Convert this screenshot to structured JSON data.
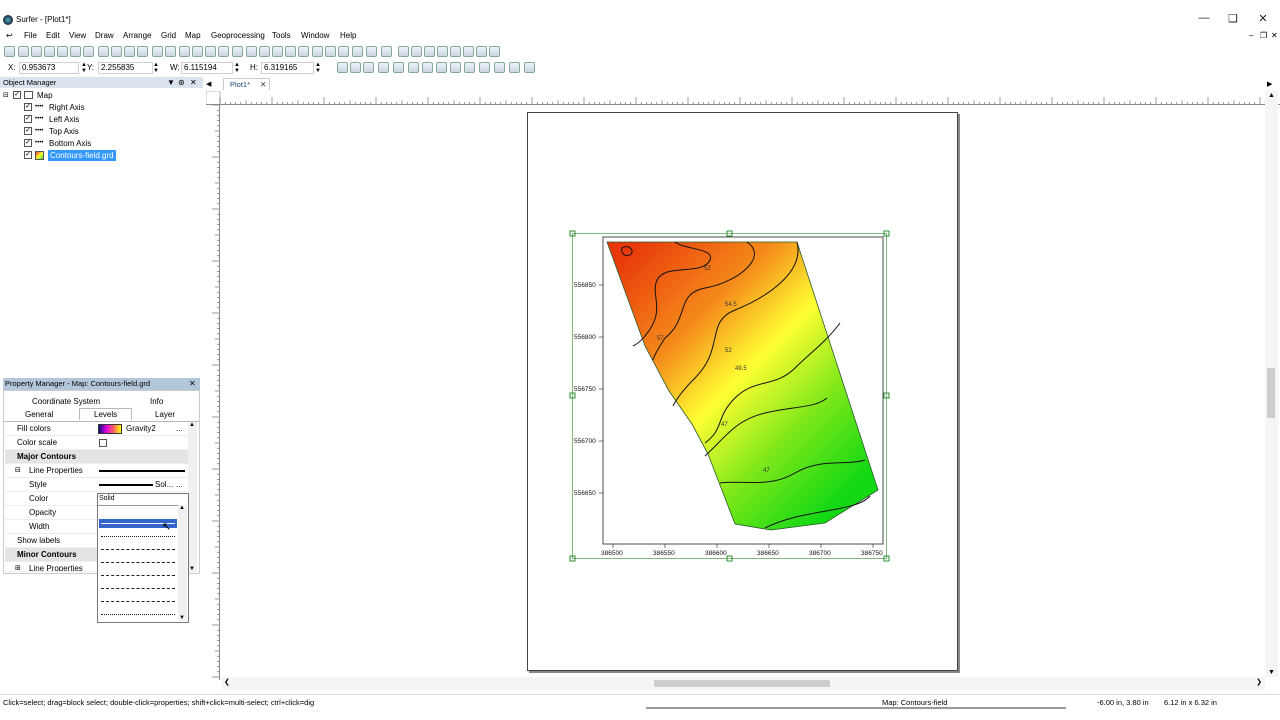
{
  "app": {
    "title": "Surfer - [Plot1*]"
  },
  "menu": [
    "File",
    "Edit",
    "View",
    "Draw",
    "Arrange",
    "Grid",
    "Map",
    "Geoprocessing",
    "Tools",
    "Window",
    "Help"
  ],
  "coords": {
    "x_label": "X:",
    "x_value": "0.953673",
    "y_label": "Y:",
    "y_value": "2.255835",
    "w_label": "W:",
    "w_value": "6.115194",
    "h_label": "H:",
    "h_value": "6.319165"
  },
  "object_manager": {
    "title": "Object Manager",
    "items": [
      {
        "label": "Map"
      },
      {
        "label": "Right Axis"
      },
      {
        "label": "Left Axis"
      },
      {
        "label": "Top Axis"
      },
      {
        "label": "Bottom Axis"
      },
      {
        "label": "Contours-field.grd"
      }
    ]
  },
  "property_manager": {
    "title": "Property Manager - Map: Contours-field.grd",
    "tabs_top": [
      "Coordinate System",
      "Info"
    ],
    "tabs_bottom": [
      "General",
      "Levels",
      "Layer"
    ],
    "rows": {
      "fill_colors": "Fill colors",
      "fill_colors_value": "Gravity2",
      "color_scale": "Color scale",
      "major_contours": "Major Contours",
      "line_properties": "Line Properties",
      "style": "Style",
      "style_value": "Sol...",
      "color": "Color",
      "opacity": "Opacity",
      "width": "Width",
      "show_labels": "Show labels",
      "minor_contours": "Minor Contours",
      "minor_line_properties": "Line Properties"
    },
    "dropdown_value": "Solid"
  },
  "document": {
    "tab": "Plot1*"
  },
  "chart_data": {
    "type": "heatmap",
    "title": "",
    "x_ticks": [
      "386500",
      "386550",
      "386600",
      "386650",
      "386700",
      "386750"
    ],
    "y_ticks": [
      "556850",
      "556800",
      "556750",
      "556700",
      "556650"
    ],
    "contour_labels": [
      "52",
      "54.5",
      "57",
      "52",
      "49.5",
      "47",
      "47"
    ],
    "colors": {
      "high": "#e8380a",
      "mid": "#ffff33",
      "low": "#14d814"
    }
  },
  "status": {
    "hint": "Click=select; drag=block select; double-click=properties; shift+click=multi-select; ctrl+click=dig",
    "object": "Map: Contours-field",
    "position": "-6.00 in, 3.80 in",
    "size": "6.12 in x 6.32 in"
  }
}
